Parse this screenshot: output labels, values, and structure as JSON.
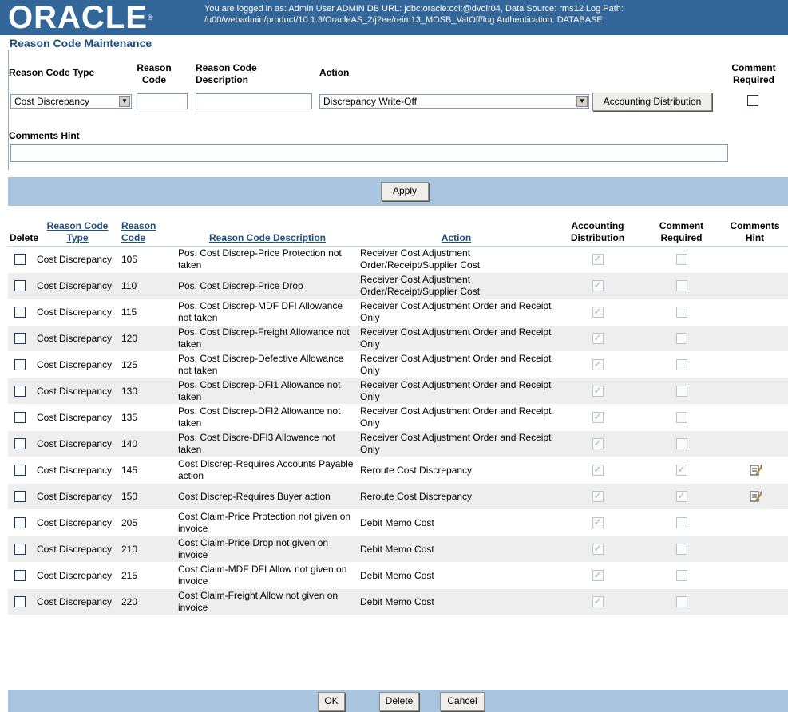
{
  "header": {
    "logo": "ORACLE",
    "info_line1": "You are logged in as: Admin User ADMIN    DB URL: jdbc:oracle:oci:@dvolr04,   Data Source: rms12  Log Path:",
    "info_line2": "/u00/webadmin/product/10.1.3/OracleAS_2/j2ee/reim13_MOSB_VatOff/log  Authentication: DATABASE"
  },
  "page_title": "Reason Code Maintenance",
  "form": {
    "reason_code_type_label": "Reason Code Type",
    "reason_code_type_value": "Cost Discrepancy",
    "reason_code_label_1": "Reason",
    "reason_code_label_2": "Code",
    "reason_code_value": "",
    "description_label_1": "Reason Code",
    "description_label_2": "Description",
    "description_value": "",
    "action_label": "Action",
    "action_value": "Discrepancy Write-Off",
    "accounting_button": "Accounting Distribution",
    "comment_required_label_1": "Comment",
    "comment_required_label_2": "Required",
    "comments_hint_label": "Comments Hint",
    "comments_hint_value": "",
    "apply_button": "Apply"
  },
  "table": {
    "headers": {
      "delete": "Delete",
      "type_1": "Reason Code",
      "type_2": "Type",
      "code_1": "Reason",
      "code_2": "Code",
      "description": "Reason Code Description",
      "action": "Action",
      "acct_1": "Accounting",
      "acct_2": "Distribution",
      "req_1": "Comment",
      "req_2": "Required",
      "hint_1": "Comments",
      "hint_2": "Hint"
    },
    "rows": [
      {
        "type": "Cost Discrepancy",
        "code": "105",
        "description": "Pos. Cost Discrep-Price Protection not taken",
        "action": "Receiver Cost Adjustment Order/Receipt/Supplier Cost",
        "accounting": true,
        "required": false,
        "hint": false
      },
      {
        "type": "Cost Discrepancy",
        "code": "110",
        "description": "Pos. Cost Discrep-Price Drop",
        "action": "Receiver Cost Adjustment Order/Receipt/Supplier Cost",
        "accounting": true,
        "required": false,
        "hint": false
      },
      {
        "type": "Cost Discrepancy",
        "code": "115",
        "description": "Pos. Cost Discrep-MDF DFI Allowance not taken",
        "action": "Receiver Cost Adjustment Order and Receipt Only",
        "accounting": true,
        "required": false,
        "hint": false
      },
      {
        "type": "Cost Discrepancy",
        "code": "120",
        "description": "Pos. Cost Discrep-Freight Allowance not taken",
        "action": "Receiver Cost Adjustment Order and Receipt Only",
        "accounting": true,
        "required": false,
        "hint": false
      },
      {
        "type": "Cost Discrepancy",
        "code": "125",
        "description": "Pos. Cost Discrep-Defective Allowance not taken",
        "action": "Receiver Cost Adjustment Order and Receipt Only",
        "accounting": true,
        "required": false,
        "hint": false
      },
      {
        "type": "Cost Discrepancy",
        "code": "130",
        "description": "Pos. Cost Discrep-DFI1 Allowance not taken",
        "action": "Receiver Cost Adjustment Order and Receipt Only",
        "accounting": true,
        "required": false,
        "hint": false
      },
      {
        "type": "Cost Discrepancy",
        "code": "135",
        "description": "Pos. Cost Discrep-DFI2 Allowance not taken",
        "action": "Receiver Cost Adjustment Order and Receipt Only",
        "accounting": true,
        "required": false,
        "hint": false
      },
      {
        "type": "Cost Discrepancy",
        "code": "140",
        "description": "Pos. Cost Discre-DFI3 Allowance not taken",
        "action": "Receiver Cost Adjustment Order and Receipt Only",
        "accounting": true,
        "required": false,
        "hint": false
      },
      {
        "type": "Cost Discrepancy",
        "code": "145",
        "description": "Cost Discrep-Requires Accounts Payable action",
        "action": "Reroute Cost Discrepancy",
        "accounting": true,
        "required": true,
        "hint": true
      },
      {
        "type": "Cost Discrepancy",
        "code": "150",
        "description": "Cost Discrep-Requires Buyer action",
        "action": "Reroute Cost Discrepancy",
        "accounting": true,
        "required": true,
        "hint": true
      },
      {
        "type": "Cost Discrepancy",
        "code": "205",
        "description": "Cost Claim-Price Protection not given on invoice",
        "action": "Debit Memo Cost",
        "accounting": true,
        "required": false,
        "hint": false
      },
      {
        "type": "Cost Discrepancy",
        "code": "210",
        "description": "Cost Claim-Price Drop not given on invoice",
        "action": "Debit Memo Cost",
        "accounting": true,
        "required": false,
        "hint": false
      },
      {
        "type": "Cost Discrepancy",
        "code": "215",
        "description": "Cost Claim-MDF DFI Allow not given on invoice",
        "action": "Debit Memo Cost",
        "accounting": true,
        "required": false,
        "hint": false
      },
      {
        "type": "Cost Discrepancy",
        "code": "220",
        "description": "Cost Claim-Freight Allow not given on invoice",
        "action": "Debit Memo Cost",
        "accounting": true,
        "required": false,
        "hint": false
      }
    ]
  },
  "footer": {
    "ok_button": "OK",
    "delete_button": "Delete",
    "cancel_button": "Cancel"
  },
  "colors": {
    "header_bg": "#336699",
    "bar_bg": "#a8c4de",
    "link": "#1f4f7f"
  },
  "icons": {
    "hint": "edit-note-icon",
    "dropdown": "chevron-down-icon"
  }
}
